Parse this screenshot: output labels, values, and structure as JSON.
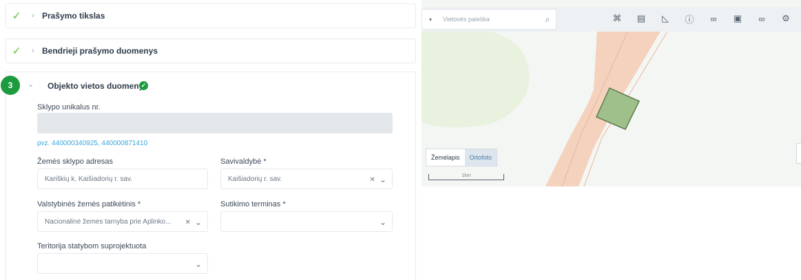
{
  "form": {
    "steps": [
      {
        "title": "Prašymo tikslas",
        "completed": true
      },
      {
        "title": "Bendrieji prašymo duomenys",
        "completed": true
      }
    ],
    "section": {
      "number": "3",
      "title": "Objekto vietos duomenys",
      "fields": {
        "cadastral": {
          "label": "Sklypo unikalus nr.",
          "value": "",
          "hint": "pvz. 440000340925, 440000871410"
        },
        "address": {
          "label": "Žemės sklypo adresas",
          "value": "Kariškių k. Kaišiadorių r. sav."
        },
        "municipality": {
          "label": "Savivaldybė *",
          "value": "Kaišiadorių r. sav."
        },
        "land_office": {
          "label": "Valstybinės žemės patikėtinis *",
          "value": "Nacionalinė žemės tarnyba prie Aplinko..."
        },
        "term": {
          "label": "Sutikimo terminas *",
          "value": ""
        },
        "territory": {
          "label": "Teritorija statybom suprojektuota",
          "value": ""
        }
      }
    }
  },
  "map": {
    "search_placeholder": "Vietovės paieška",
    "tools": [
      "select-icon",
      "document-icon",
      "measure-icon",
      "info-icon",
      "link-icon",
      "pdf-icon",
      "layers-icon",
      "settings-icon"
    ],
    "tabs": [
      {
        "label": "Žemėlapis",
        "active": false
      },
      {
        "label": "Ortofoto",
        "active": true
      }
    ],
    "scale_label": "1km",
    "colors": {
      "forest": "#e8f2df",
      "road_band": "#f4d2bd",
      "parcel_fill": "#9fc08a",
      "parcel_stroke": "#5b7a4b",
      "accent_green": "#1e9b3f"
    }
  }
}
